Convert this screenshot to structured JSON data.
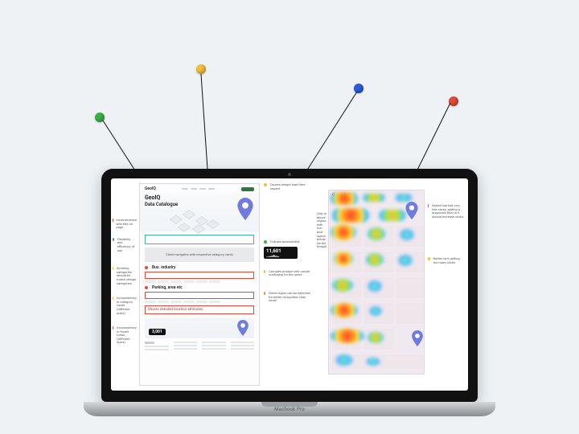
{
  "laptop_label": "Macbook Pro",
  "pins": {
    "green": "#3bb04a",
    "yellow": "#f2c037",
    "blue": "#2e5bd8",
    "red": "#e14a3a"
  },
  "left_panel": {
    "brand": "GeoIQ",
    "page_title": "Data Catalogue",
    "teal_box": "",
    "grey_banner": "Client navigates with respective category cards",
    "section1": {
      "title": "Bus. industry"
    },
    "section2": {
      "title": "Parking, area etc"
    },
    "lower_redbox_text": "Shares detailed location attributes",
    "cta_metric": "3,001"
  },
  "callouts_left_left": {
    "c1": "Inconvenience with title on page",
    "c2": "Flexibility and efficiency of use",
    "c3": "Scrolling categories should be match design categories",
    "c4": "Inconsistency in category cards (different sizes)",
    "c5": "Inconsistency in footer menu (different sizes)"
  },
  "callouts_left_right": {
    "top": "Causes weight load time impact",
    "c1": "Follows accessibility",
    "metric1": "11,601",
    "c2": "Complex product info can be confusing for the users",
    "c3": "Client region can be selective, for better recognition than recall"
  },
  "heatmap": {
    "brand": "GeoIQ"
  },
  "callouts_right_left": {
    "c1": "Only in above region, with rich blue space below (at the image)"
  },
  "callouts_right_right": {
    "c1": "Search bar has very few clicks, adding a dropdown filter in it should increase clicks",
    "c2": "Button isn't getting too many clicks"
  }
}
